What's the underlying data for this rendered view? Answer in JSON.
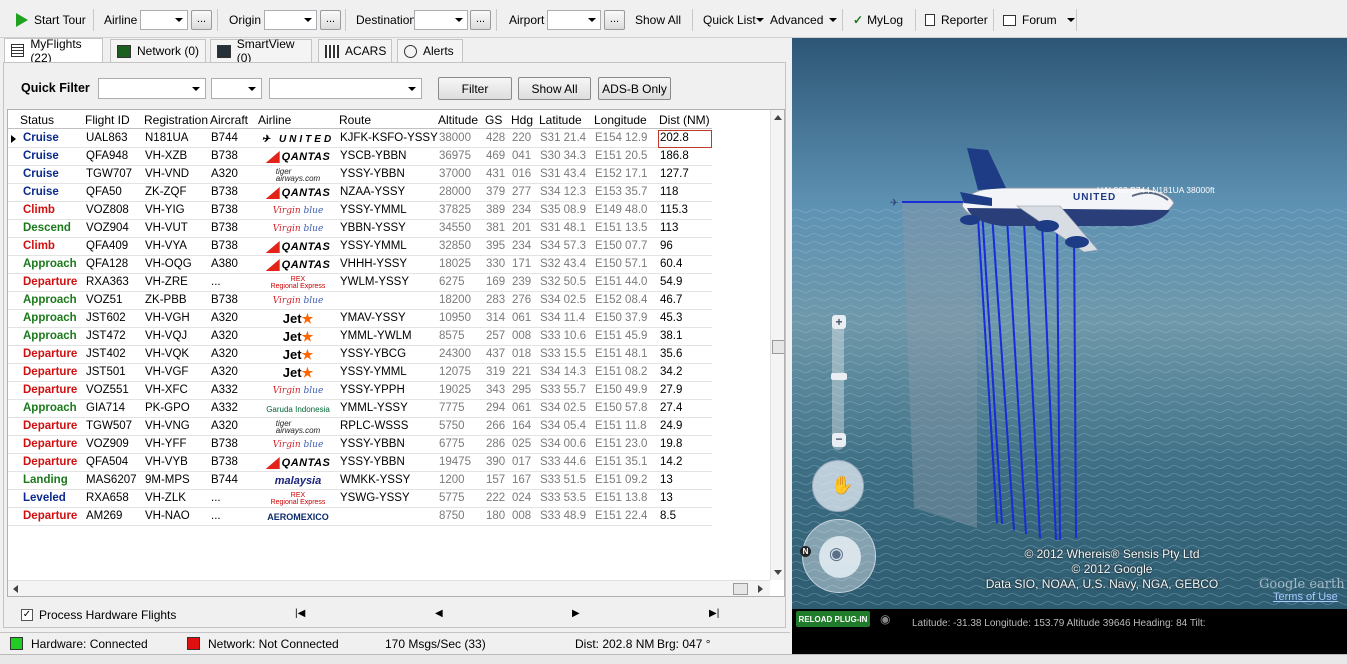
{
  "toolbar": {
    "start_tour": "Start Tour",
    "airline_label": "Airline",
    "origin_label": "Origin",
    "destination_label": "Destination",
    "airport_label": "Airport",
    "browse": "...",
    "show_all": "Show All",
    "quick_list": "Quick List",
    "advanced": "Advanced",
    "mylog": "MyLog",
    "reporter": "Reporter",
    "forum": "Forum"
  },
  "tabs": [
    {
      "label": "MyFlights (22)",
      "active": true
    },
    {
      "label": "Network (0)"
    },
    {
      "label": "SmartView (0)"
    },
    {
      "label": "ACARS"
    },
    {
      "label": "Alerts"
    }
  ],
  "quick_filter": {
    "label": "Quick Filter",
    "filter_button": "Filter",
    "show_all_button": "Show All",
    "adsb_button": "ADS-B Only"
  },
  "columns": [
    "Status",
    "Flight ID",
    "Registration",
    "Aircraft",
    "Airline",
    "Route",
    "Altitude",
    "GS",
    "Hdg",
    "Latitude",
    "Longitude",
    "Dist (NM)"
  ],
  "flights": [
    {
      "status": "Cruise",
      "flight": "UAL863",
      "reg": "N181UA",
      "ac": "B744",
      "airline": "United",
      "route": "KJFK-KSFO-YSSY",
      "alt": "38000",
      "gs": "428",
      "hdg": "220",
      "lat": "S31 21.4",
      "lon": "E154 12.9",
      "dist": "202.8"
    },
    {
      "status": "Cruise",
      "flight": "QFA948",
      "reg": "VH-XZB",
      "ac": "B738",
      "airline": "Qantas",
      "route": "YSCB-YBBN",
      "alt": "36975",
      "gs": "469",
      "hdg": "041",
      "lat": "S30 34.3",
      "lon": "E151 20.5",
      "dist": "186.8"
    },
    {
      "status": "Cruise",
      "flight": "TGW707",
      "reg": "VH-VND",
      "ac": "A320",
      "airline": "Tiger",
      "route": "YSSY-YBBN",
      "alt": "37000",
      "gs": "431",
      "hdg": "016",
      "lat": "S31 43.4",
      "lon": "E152 17.1",
      "dist": "127.7"
    },
    {
      "status": "Cruise",
      "flight": "QFA50",
      "reg": "ZK-ZQF",
      "ac": "B738",
      "airline": "Qantas",
      "route": "NZAA-YSSY",
      "alt": "28000",
      "gs": "379",
      "hdg": "277",
      "lat": "S34 12.3",
      "lon": "E153 35.7",
      "dist": "118"
    },
    {
      "status": "Climb",
      "flight": "VOZ808",
      "reg": "VH-YIG",
      "ac": "B738",
      "airline": "Virgin",
      "route": "YSSY-YMML",
      "alt": "37825",
      "gs": "389",
      "hdg": "234",
      "lat": "S35 08.9",
      "lon": "E149 48.0",
      "dist": "115.3"
    },
    {
      "status": "Descend",
      "flight": "VOZ904",
      "reg": "VH-VUT",
      "ac": "B738",
      "airline": "Virgin",
      "route": "YBBN-YSSY",
      "alt": "34550",
      "gs": "381",
      "hdg": "201",
      "lat": "S31 48.1",
      "lon": "E151 13.5",
      "dist": "113"
    },
    {
      "status": "Climb",
      "flight": "QFA409",
      "reg": "VH-VYA",
      "ac": "B738",
      "airline": "Qantas",
      "route": "YSSY-YMML",
      "alt": "32850",
      "gs": "395",
      "hdg": "234",
      "lat": "S34 57.3",
      "lon": "E150 07.7",
      "dist": "96"
    },
    {
      "status": "Approach",
      "flight": "QFA128",
      "reg": "VH-OQG",
      "ac": "A380",
      "airline": "Qantas",
      "route": "VHHH-YSSY",
      "alt": "18025",
      "gs": "330",
      "hdg": "171",
      "lat": "S32 43.4",
      "lon": "E150 57.1",
      "dist": "60.4"
    },
    {
      "status": "Departure",
      "flight": "RXA363",
      "reg": "VH-ZRE",
      "ac": "...",
      "airline": "Rex",
      "route": "YWLM-YSSY",
      "alt": "6275",
      "gs": "169",
      "hdg": "239",
      "lat": "S32 50.5",
      "lon": "E151 44.0",
      "dist": "54.9"
    },
    {
      "status": "Approach",
      "flight": "VOZ51",
      "reg": "ZK-PBB",
      "ac": "B738",
      "airline": "Virgin",
      "route": "",
      "alt": "18200",
      "gs": "283",
      "hdg": "276",
      "lat": "S34 02.5",
      "lon": "E152 08.4",
      "dist": "46.7"
    },
    {
      "status": "Approach",
      "flight": "JST602",
      "reg": "VH-VGH",
      "ac": "A320",
      "airline": "Jetstar",
      "route": "YMAV-YSSY",
      "alt": "10950",
      "gs": "314",
      "hdg": "061",
      "lat": "S34 11.4",
      "lon": "E150 37.9",
      "dist": "45.3"
    },
    {
      "status": "Approach",
      "flight": "JST472",
      "reg": "VH-VQJ",
      "ac": "A320",
      "airline": "Jetstar",
      "route": "YMML-YWLM",
      "alt": "8575",
      "gs": "257",
      "hdg": "008",
      "lat": "S33 10.6",
      "lon": "E151 45.9",
      "dist": "38.1"
    },
    {
      "status": "Departure",
      "flight": "JST402",
      "reg": "VH-VQK",
      "ac": "A320",
      "airline": "Jetstar",
      "route": "YSSY-YBCG",
      "alt": "24300",
      "gs": "437",
      "hdg": "018",
      "lat": "S33 15.5",
      "lon": "E151 48.1",
      "dist": "35.6"
    },
    {
      "status": "Departure",
      "flight": "JST501",
      "reg": "VH-VGF",
      "ac": "A320",
      "airline": "Jetstar",
      "route": "YSSY-YMML",
      "alt": "12075",
      "gs": "319",
      "hdg": "221",
      "lat": "S34 14.3",
      "lon": "E151 08.2",
      "dist": "34.2"
    },
    {
      "status": "Departure",
      "flight": "VOZ551",
      "reg": "VH-XFC",
      "ac": "A332",
      "airline": "Virgin",
      "route": "YSSY-YPPH",
      "alt": "19025",
      "gs": "343",
      "hdg": "295",
      "lat": "S33 55.7",
      "lon": "E150 49.9",
      "dist": "27.9"
    },
    {
      "status": "Approach",
      "flight": "GIA714",
      "reg": "PK-GPO",
      "ac": "A332",
      "airline": "Garuda",
      "route": "YMML-YSSY",
      "alt": "7775",
      "gs": "294",
      "hdg": "061",
      "lat": "S34 02.5",
      "lon": "E150 57.8",
      "dist": "27.4"
    },
    {
      "status": "Departure",
      "flight": "TGW507",
      "reg": "VH-VNG",
      "ac": "A320",
      "airline": "Tiger",
      "route": "RPLC-WSSS",
      "alt": "5750",
      "gs": "266",
      "hdg": "164",
      "lat": "S34 05.4",
      "lon": "E151 11.8",
      "dist": "24.9"
    },
    {
      "status": "Departure",
      "flight": "VOZ909",
      "reg": "VH-YFF",
      "ac": "B738",
      "airline": "Virgin",
      "route": "YSSY-YBBN",
      "alt": "6775",
      "gs": "286",
      "hdg": "025",
      "lat": "S34 00.6",
      "lon": "E151 23.0",
      "dist": "19.8"
    },
    {
      "status": "Departure",
      "flight": "QFA504",
      "reg": "VH-VYB",
      "ac": "B738",
      "airline": "Qantas",
      "route": "YSSY-YBBN",
      "alt": "19475",
      "gs": "390",
      "hdg": "017",
      "lat": "S33 44.6",
      "lon": "E151 35.1",
      "dist": "14.2"
    },
    {
      "status": "Landing",
      "flight": "MAS6207",
      "reg": "9M-MPS",
      "ac": "B744",
      "airline": "Malaysia",
      "route": "WMKK-YSSY",
      "alt": "1200",
      "gs": "157",
      "hdg": "167",
      "lat": "S33 51.5",
      "lon": "E151 09.2",
      "dist": "13"
    },
    {
      "status": "Leveled",
      "flight": "RXA658",
      "reg": "VH-ZLK",
      "ac": "...",
      "airline": "Rex",
      "route": "YSWG-YSSY",
      "alt": "5775",
      "gs": "222",
      "hdg": "024",
      "lat": "S33 53.5",
      "lon": "E151 13.8",
      "dist": "13"
    },
    {
      "status": "Departure",
      "flight": "AM269",
      "reg": "VH-NAO",
      "ac": "...",
      "airline": "Aeromexico",
      "route": "",
      "alt": "8750",
      "gs": "180",
      "hdg": "008",
      "lat": "S33 48.9",
      "lon": "E151 22.4",
      "dist": "8.5"
    }
  ],
  "status_colors": {
    "Cruise": "#0a2a8c",
    "Climb": "#d01010",
    "Descend": "#1a7a1a",
    "Approach": "#1a7a1a",
    "Departure": "#d01010",
    "Landing": "#1a7a1a",
    "Leveled": "#0a2a8c"
  },
  "bottom": {
    "process_hw": "Process Hardware Flights"
  },
  "statusbar": {
    "hardware": "Hardware: Connected",
    "network": "Network: Not Connected",
    "msgs": "170 Msgs/Sec (33)",
    "dist": "Dist: 202.8 NM",
    "brg": "Brg: 047 °"
  },
  "map": {
    "plane_label": "UAL863 B744 N181UA 38000ft",
    "plane_text": "UNITED",
    "credit1": "© 2012 Whereis® Sensis Pty Ltd",
    "credit2": "© 2012 Google",
    "credit3": "Data SIO, NOAA, U.S. Navy, NGA, GEBCO",
    "google": "Google earth",
    "terms": "Terms of Use",
    "reload": "RELOAD PLUG-IN",
    "info": "Latitude: -31.38 Longitude: 153.79 Altitude 39646 Heading: 84 Tilt:"
  }
}
